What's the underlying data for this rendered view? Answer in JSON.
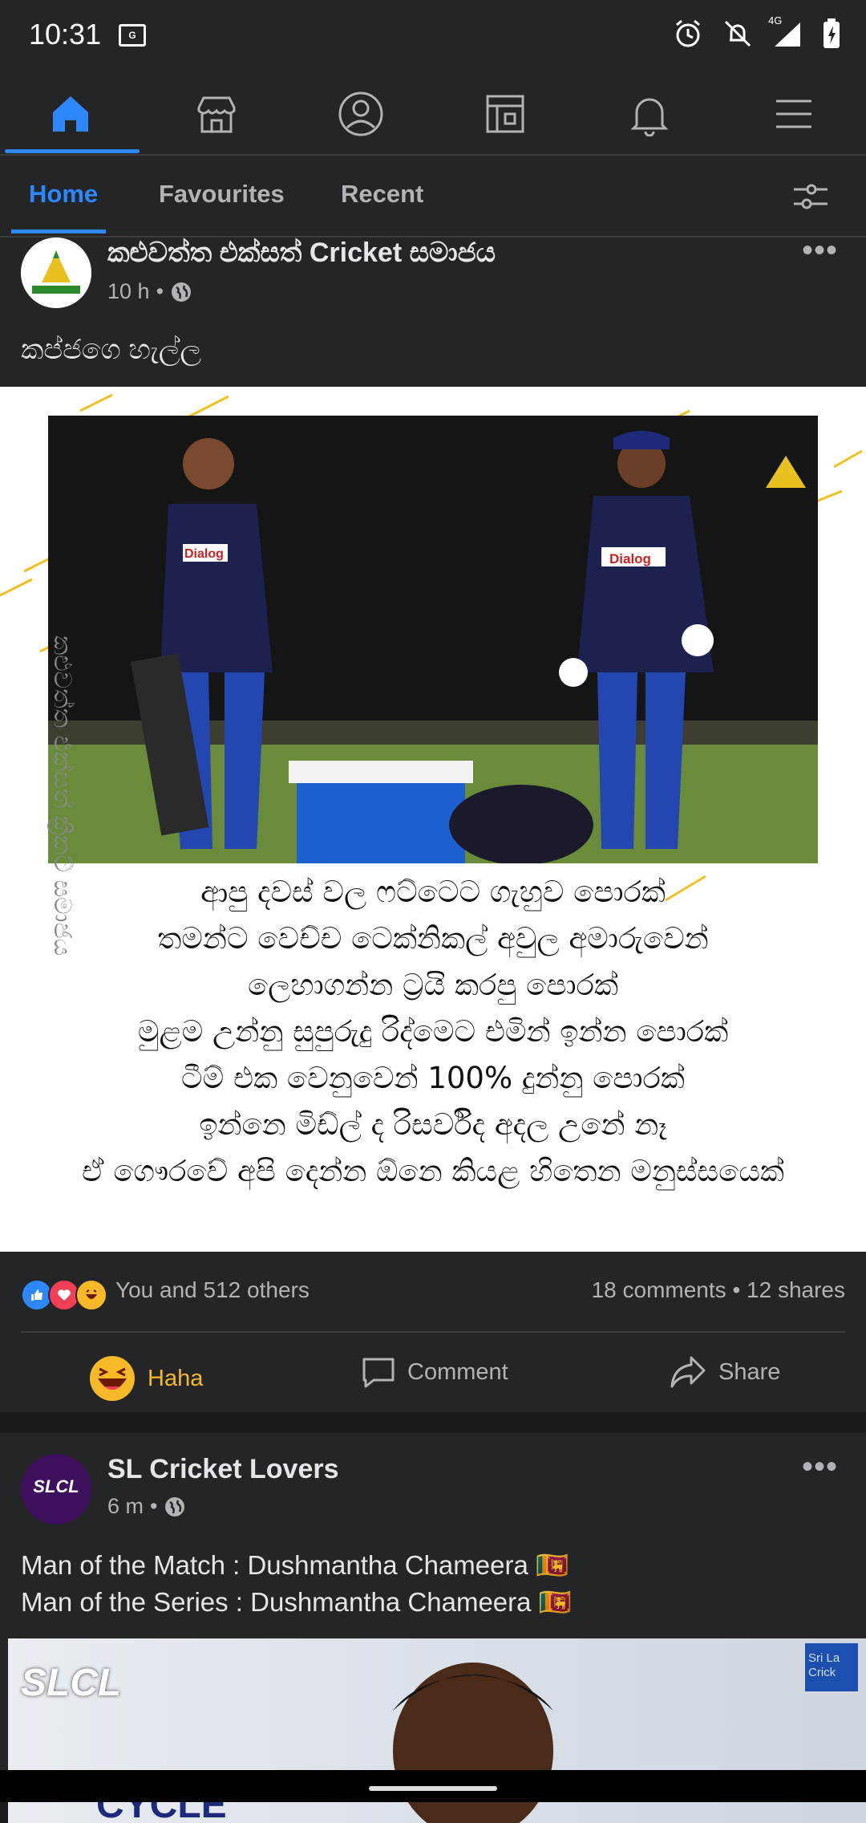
{
  "status_bar": {
    "time": "10:31",
    "sim_label": "G",
    "network": "4G"
  },
  "nav": {
    "icons": [
      "home-icon",
      "marketplace-icon",
      "profile-icon",
      "pages-icon",
      "notifications-icon",
      "menu-icon"
    ]
  },
  "subnav": {
    "tabs": [
      "Home",
      "Favourites",
      "Recent"
    ],
    "active": "Home"
  },
  "post1": {
    "author": "කළුවත්ත එක්සත් Cricket සමාජය",
    "time": "10 h",
    "text": "කප්ජගෙ හැල්ල",
    "caption_lines": [
      "ආපු දවස් වල ෆට්ටෙට ගැහුව පොරක්",
      "තමන්ට වෙච්ච ටෙක්නිකල් අවුල අමාරුවෙන්",
      "ලෙහාගන්න ට්‍රයි කරපු පොරක්",
      "මුළම උන්නු සුපුරුදු රිද්මෙට එමින් ඉන්න පොරක්",
      "ටීම් එක වෙනුවෙන් 100% දුන්නු පොරක්",
      "ඉන්නෙ මිඩ්ල් ද රිසර්විද අදල උනේ නෑ",
      "ඒ ගෞරවේ අපි දෙන්න ඕනෙ කියළ හිතෙන මනුස්සයෙක්"
    ],
    "watermark": "කළුවත්ත එක්සත් ක්‍රිකට් සමාජය",
    "jersey_text": "Dialog",
    "reactions_text": "You and 512 others",
    "stats": "18 comments • 12 shares",
    "actions": {
      "haha": "Haha",
      "comment": "Comment",
      "share": "Share"
    }
  },
  "post2": {
    "author": "SL Cricket Lovers",
    "avatar_text": "SLCL",
    "time": "6 m",
    "line1": "Man of the Match : Dushmantha Chameera 🇱🇰",
    "line2": "Man of the Series : Dushmantha Chameera 🇱🇰",
    "image_logo": "SLCL",
    "image_text": "CYCLE",
    "image_corner": "Sri La Crick"
  },
  "colors": {
    "accent": "#2d88ff",
    "haha": "#f7b928",
    "bg": "#242526"
  }
}
